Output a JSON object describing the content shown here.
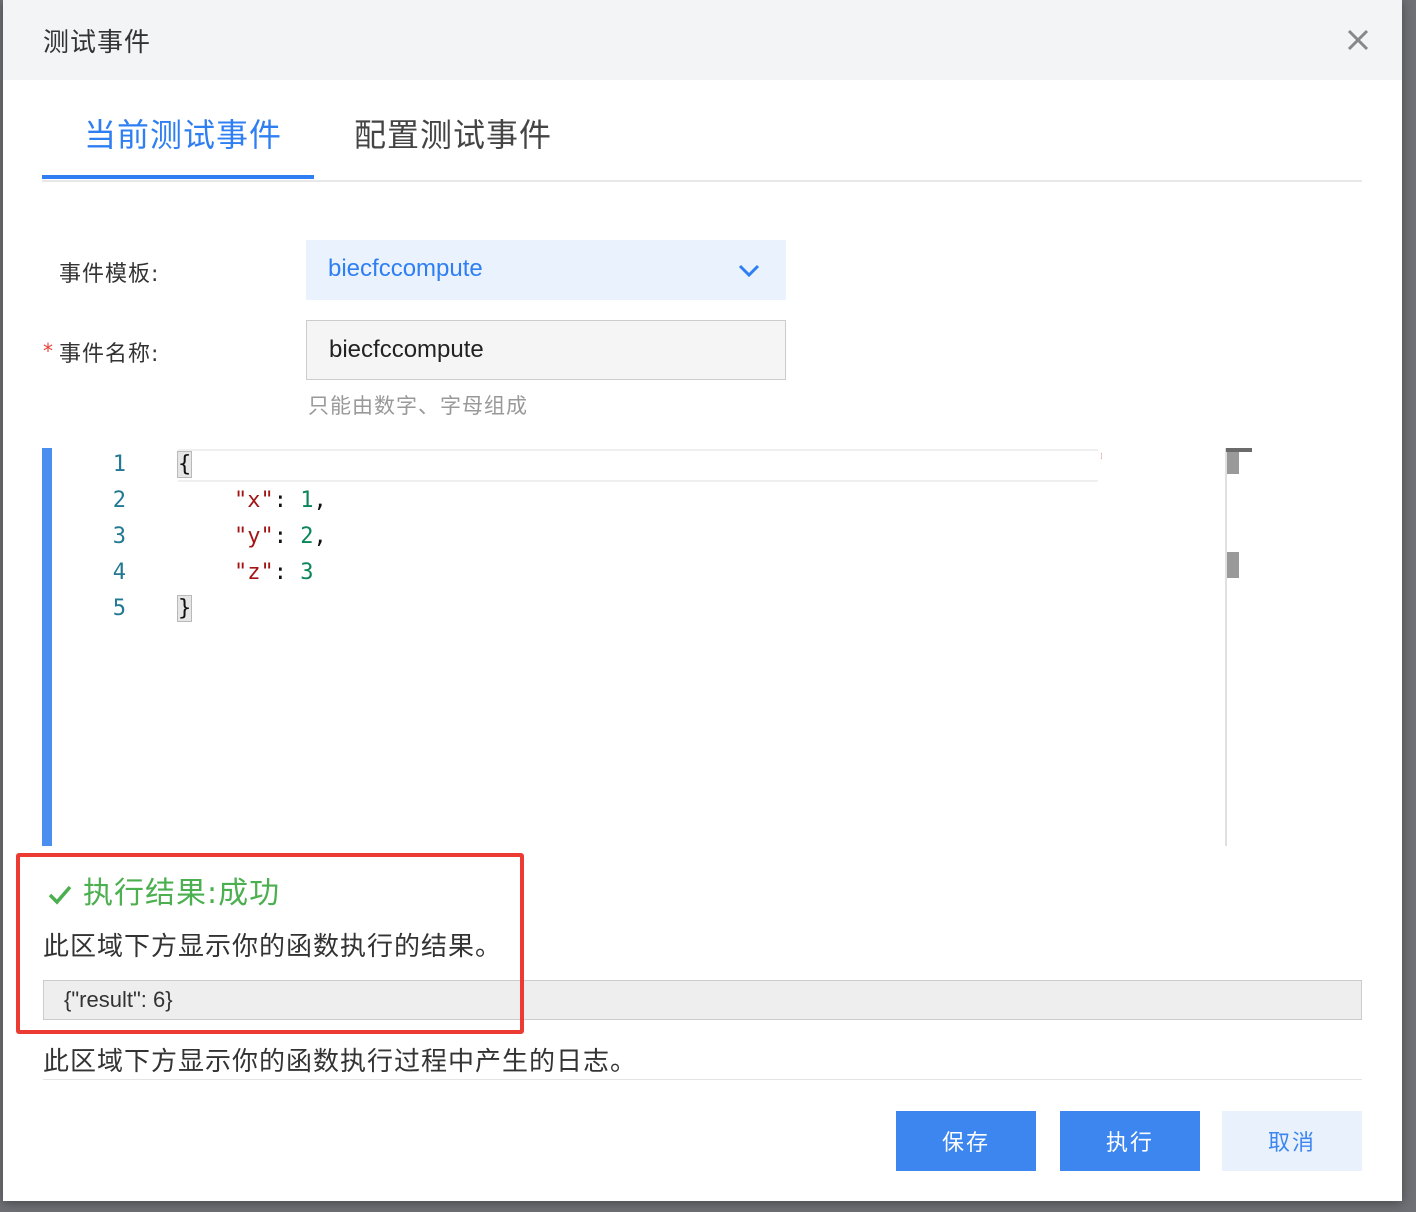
{
  "dialog": {
    "title": "测试事件"
  },
  "tabs": [
    {
      "label": "当前测试事件",
      "active": true
    },
    {
      "label": "配置测试事件",
      "active": false
    }
  ],
  "form": {
    "template_label": "事件模板:",
    "template_value": "biecfccompute",
    "name_label": "事件名称:",
    "name_value": "biecfccompute",
    "name_hint": "只能由数字、字母组成",
    "required_mark": "*"
  },
  "editor": {
    "line_numbers": [
      "1",
      "2",
      "3",
      "4",
      "5"
    ],
    "lines": {
      "l1_open": "{",
      "l2_key": "\"x\"",
      "l2_sep": ": ",
      "l2_val": "1",
      "l2_end": ",",
      "l3_key": "\"y\"",
      "l3_sep": ": ",
      "l3_val": "2",
      "l3_end": ",",
      "l4_key": "\"z\"",
      "l4_sep": ": ",
      "l4_val": "3",
      "l5_close": "}"
    }
  },
  "result": {
    "status": "执行结果:成功",
    "result_desc": "此区域下方显示你的函数执行的结果。",
    "result_value": "{\"result\": 6}",
    "log_desc": "此区域下方显示你的函数执行过程中产生的日志。"
  },
  "buttons": {
    "save": "保存",
    "execute": "执行",
    "cancel": "取消"
  },
  "colors": {
    "primary": "#3d86f0",
    "tab_active": "#2f7ff3",
    "success": "#4caf50",
    "highlight_frame": "#ec3b33"
  }
}
